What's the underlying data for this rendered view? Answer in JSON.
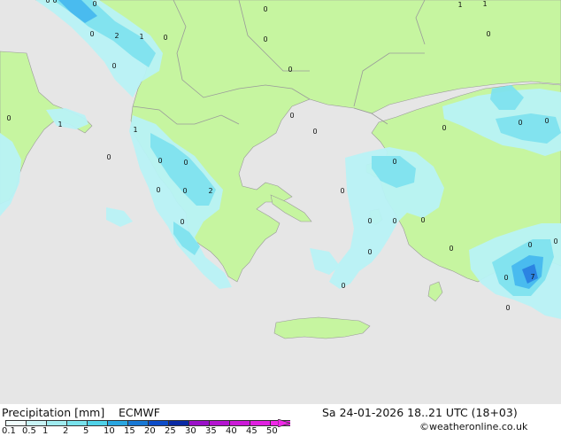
{
  "map": {
    "colors": {
      "sea": "#e6e6e6",
      "land": "#c6f5a0",
      "border": "#9a9a9a",
      "precip_light": "#b8f2f5",
      "precip_mid": "#7ee2ee",
      "precip_heavy": "#46b8ee",
      "precip_peak": "#2a7fe0"
    },
    "point_values": [
      "0",
      "0",
      "2",
      "1",
      "0",
      "0",
      "0",
      "0",
      "0",
      "1",
      "0",
      "1",
      "0",
      "0",
      "0",
      "0",
      "0",
      "2",
      "0",
      "0",
      "0",
      "0",
      "0",
      "0",
      "0",
      "0",
      "0",
      "0",
      "0",
      "0",
      "1",
      "1",
      "0",
      "0",
      "0",
      "7",
      "0",
      "0",
      "0",
      "0",
      "0",
      "0"
    ]
  },
  "footer": {
    "title": "Precipitation [mm]",
    "model": "ECMWF",
    "datetime": "Sa 24-01-2026 18..21 UTC (18+03)",
    "credit": "©weatheronline.co.uk"
  },
  "legend": {
    "labels": [
      "0.1",
      "0.5",
      "1",
      "2",
      "5",
      "10",
      "15",
      "20",
      "25",
      "30",
      "35",
      "40",
      "45",
      "50"
    ],
    "colors": [
      "#f0fcfc",
      "#c8f4f6",
      "#a0ecf0",
      "#78e2ec",
      "#50d2e8",
      "#2aa6e0",
      "#1878d4",
      "#0d4cc8",
      "#0a2aa4",
      "#9a10c8",
      "#b414d0",
      "#cc1ad8",
      "#e020e0",
      "#f028e8"
    ]
  }
}
